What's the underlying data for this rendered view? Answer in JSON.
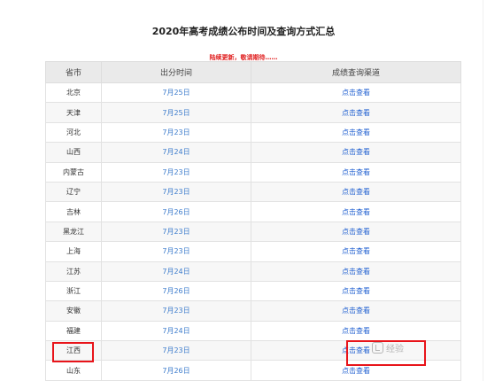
{
  "page": {
    "title": "2020年高考成绩公布时间及查询方式汇总",
    "notice": "陆续更新，敬请期待……"
  },
  "table": {
    "headers": {
      "province": "省市",
      "date": "出分时间",
      "channel": "成绩查询渠道"
    },
    "rows": [
      {
        "province": "北京",
        "date": "7月25日",
        "link": "点击查看"
      },
      {
        "province": "天津",
        "date": "7月25日",
        "link": "点击查看"
      },
      {
        "province": "河北",
        "date": "7月23日",
        "link": "点击查看"
      },
      {
        "province": "山西",
        "date": "7月24日",
        "link": "点击查看"
      },
      {
        "province": "内蒙古",
        "date": "7月23日",
        "link": "点击查看"
      },
      {
        "province": "辽宁",
        "date": "7月23日",
        "link": "点击查看"
      },
      {
        "province": "吉林",
        "date": "7月26日",
        "link": "点击查看"
      },
      {
        "province": "黑龙江",
        "date": "7月23日",
        "link": "点击查看"
      },
      {
        "province": "上海",
        "date": "7月23日",
        "link": "点击查看"
      },
      {
        "province": "江苏",
        "date": "7月24日",
        "link": "点击查看"
      },
      {
        "province": "浙江",
        "date": "7月26日",
        "link": "点击查看"
      },
      {
        "province": "安徽",
        "date": "7月23日",
        "link": "点击查看"
      },
      {
        "province": "福建",
        "date": "7月24日",
        "link": "点击查看"
      },
      {
        "province": "江西",
        "date": "7月23日",
        "link": "点击查看"
      },
      {
        "province": "山东",
        "date": "7月26日",
        "link": "点击查看"
      }
    ]
  },
  "watermark": {
    "text": "经验",
    "icon": "baidu-jingyan-logo-icon"
  },
  "colors": {
    "highlight": "#e8141a",
    "link": "#1f5fd0",
    "date": "#3d7ccc",
    "notice": "#e02020",
    "header_bg": "#eaeaea"
  }
}
